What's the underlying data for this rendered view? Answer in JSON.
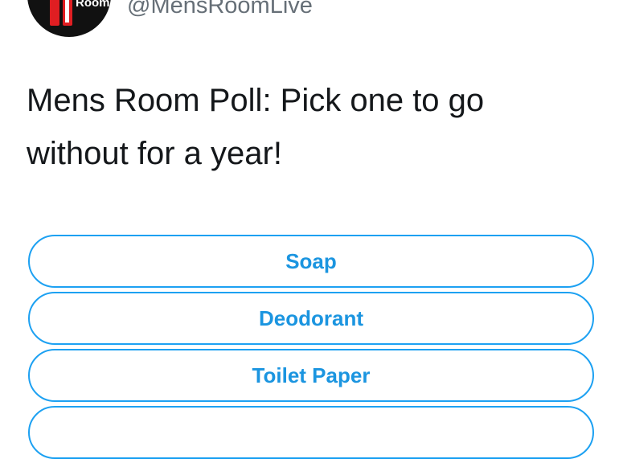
{
  "account": {
    "avatar_logo_text": "Room",
    "handle": "@MensRoomLive"
  },
  "tweet": {
    "text": "Mens Room Poll: Pick one to go without for a year!"
  },
  "poll": {
    "options": [
      {
        "label": "Soap"
      },
      {
        "label": "Deodorant"
      },
      {
        "label": "Toilet Paper"
      },
      {
        "label": ""
      }
    ]
  },
  "colors": {
    "accent": "#1da1f2",
    "option_text": "#1b95e0",
    "handle_text": "#666f77",
    "body_text": "#14171a",
    "logo_red": "#e01e22"
  }
}
